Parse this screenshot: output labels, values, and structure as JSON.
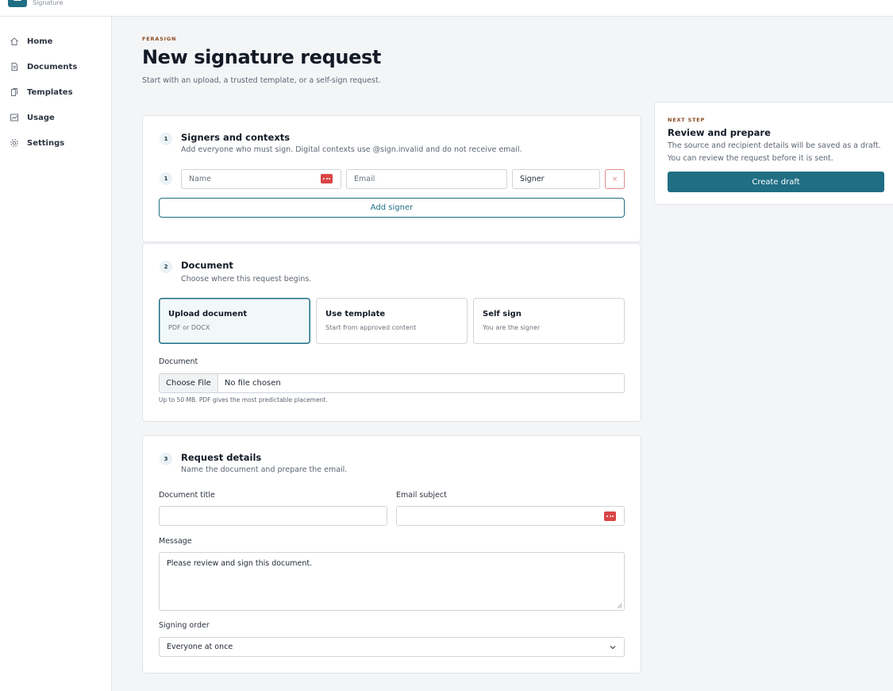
{
  "brand": {
    "subtitle": "Signature"
  },
  "sidebar": {
    "items": [
      {
        "label": "Home",
        "icon": "home-icon"
      },
      {
        "label": "Documents",
        "icon": "document-icon"
      },
      {
        "label": "Templates",
        "icon": "templates-icon"
      },
      {
        "label": "Usage",
        "icon": "chart-icon"
      },
      {
        "label": "Settings",
        "icon": "gear-icon"
      }
    ]
  },
  "header": {
    "eyebrow": "FERASIGN",
    "title": "New signature request",
    "subtitle": "Start with an upload, a trusted template, or a self-sign request."
  },
  "signers": {
    "step": "1",
    "title": "Signers and contexts",
    "description": "Add everyone who must sign. Digital contexts use @sign.invalid and do not receive email.",
    "rows": [
      {
        "index": "1",
        "name_placeholder": "Name",
        "email_placeholder": "Email",
        "role": "Signer",
        "remove_label": "×"
      }
    ],
    "add_label": "Add signer"
  },
  "document": {
    "step": "2",
    "title": "Document",
    "description": "Choose where this request begins.",
    "options": [
      {
        "title": "Upload document",
        "desc": "PDF or DOCX",
        "selected": true
      },
      {
        "title": "Use template",
        "desc": "Start from approved content",
        "selected": false
      },
      {
        "title": "Self sign",
        "desc": "You are the signer",
        "selected": false
      }
    ],
    "field_label": "Document",
    "file_button": "Choose File",
    "file_status": "No file chosen",
    "hint": "Up to 50 MB. PDF gives the most predictable placement."
  },
  "details": {
    "step": "3",
    "title": "Request details",
    "description": "Name the document and prepare the email.",
    "doc_title_label": "Document title",
    "doc_title_value": "",
    "email_subject_label": "Email subject",
    "email_subject_value": "",
    "message_label": "Message",
    "message_value": "Please review and sign this document.",
    "order_label": "Signing order",
    "order_value": "Everyone at once"
  },
  "next_step": {
    "eyebrow": "NEXT STEP",
    "title": "Review and prepare",
    "description": "The source and recipient details will be saved as a draft. You can review the request before it is sent.",
    "button": "Create draft"
  },
  "colors": {
    "accent": "#1f6e84",
    "eyebrow": "#8a4a1f",
    "danger": "#d94545"
  }
}
